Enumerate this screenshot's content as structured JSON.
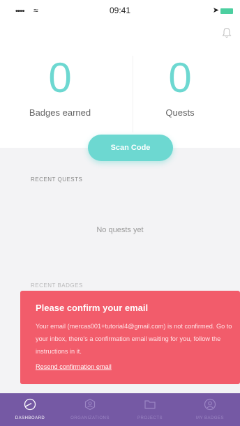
{
  "status_bar": {
    "signal": "•••••",
    "time": "09:41"
  },
  "stats": [
    {
      "value": "0",
      "label": "Badges earned"
    },
    {
      "value": "0",
      "label": "Quests"
    }
  ],
  "scan_button": {
    "label": "Scan Code"
  },
  "recent_quests": {
    "title": "RECENT QUESTS",
    "empty": "No quests yet"
  },
  "hidden_section": {
    "title": "RECENT BADGES"
  },
  "alert": {
    "title": "Please confirm your email",
    "body": "Your email (mercas001+tutorial4@gmail.com) is not confirmed. Go to your inbox, there's a confirmation email waiting for you, follow the instructions in it.",
    "link": "Resend confirmation email"
  },
  "tabs": [
    {
      "label": "DASHBOARD",
      "icon": "dashboard-icon",
      "active": true
    },
    {
      "label": "ORGANIZATIONS",
      "icon": "organizations-icon",
      "active": false
    },
    {
      "label": "PROJECTS",
      "icon": "projects-icon",
      "active": false
    },
    {
      "label": "MY BADGES",
      "icon": "badges-icon",
      "active": false
    }
  ],
  "colors": {
    "accent": "#6dd8d1",
    "alert": "#f25c6b",
    "tabbar": "#7559a4"
  }
}
